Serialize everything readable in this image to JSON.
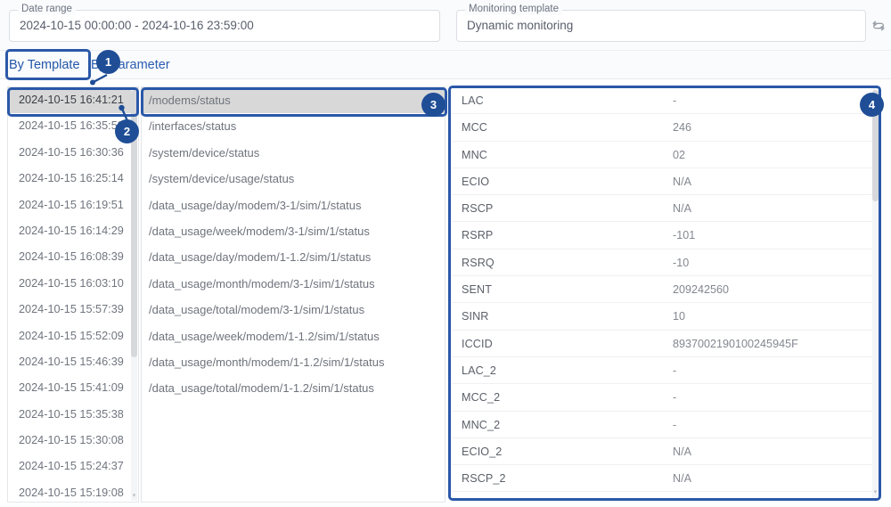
{
  "filters": {
    "date_range": {
      "label": "Date range",
      "value": "2024-10-15 00:00:00 - 2024-10-16 23:59:00"
    },
    "monitoring_template": {
      "label": "Monitoring template",
      "value": "Dynamic monitoring"
    },
    "swap_icon": "swap-arrows-icon"
  },
  "tabs": [
    {
      "label": "By Template",
      "active": true
    },
    {
      "label": "By Parameter",
      "active": false
    }
  ],
  "timestamps": {
    "selected_index": 0,
    "items": [
      "2024-10-15 16:41:21",
      "2024-10-15 16:35:59",
      "2024-10-15 16:30:36",
      "2024-10-15 16:25:14",
      "2024-10-15 16:19:51",
      "2024-10-15 16:14:29",
      "2024-10-15 16:08:39",
      "2024-10-15 16:03:10",
      "2024-10-15 15:57:39",
      "2024-10-15 15:52:09",
      "2024-10-15 15:46:39",
      "2024-10-15 15:41:09",
      "2024-10-15 15:35:38",
      "2024-10-15 15:30:08",
      "2024-10-15 15:24:37",
      "2024-10-15 15:19:08"
    ]
  },
  "paths": {
    "selected_index": 0,
    "items": [
      "/modems/status",
      "/interfaces/status",
      "/system/device/status",
      "/system/device/usage/status",
      "/data_usage/day/modem/3-1/sim/1/status",
      "/data_usage/week/modem/3-1/sim/1/status",
      "/data_usage/day/modem/1-1.2/sim/1/status",
      "/data_usage/month/modem/3-1/sim/1/status",
      "/data_usage/total/modem/3-1/sim/1/status",
      "/data_usage/week/modem/1-1.2/sim/1/status",
      "/data_usage/month/modem/1-1.2/sim/1/status",
      "/data_usage/total/modem/1-1.2/sim/1/status"
    ]
  },
  "detail": {
    "rows": [
      {
        "key": "LAC",
        "value": "-"
      },
      {
        "key": "MCC",
        "value": "246"
      },
      {
        "key": "MNC",
        "value": "02"
      },
      {
        "key": "ECIO",
        "value": "N/A"
      },
      {
        "key": "RSCP",
        "value": "N/A"
      },
      {
        "key": "RSRP",
        "value": "-101"
      },
      {
        "key": "RSRQ",
        "value": "-10"
      },
      {
        "key": "SENT",
        "value": "209242560"
      },
      {
        "key": "SINR",
        "value": "10"
      },
      {
        "key": "ICCID",
        "value": "8937002190100245945F"
      },
      {
        "key": "LAC_2",
        "value": "-"
      },
      {
        "key": "MCC_2",
        "value": "-"
      },
      {
        "key": "MNC_2",
        "value": "-"
      },
      {
        "key": "ECIO_2",
        "value": "N/A"
      },
      {
        "key": "RSCP_2",
        "value": "N/A"
      }
    ]
  },
  "annotations": {
    "badges": [
      "1",
      "2",
      "3",
      "4"
    ]
  },
  "colors": {
    "accent": "#2a58a8",
    "badge": "#1f4e96",
    "selected_row": "#d8d8d8",
    "tab_text": "#2a5db0"
  }
}
